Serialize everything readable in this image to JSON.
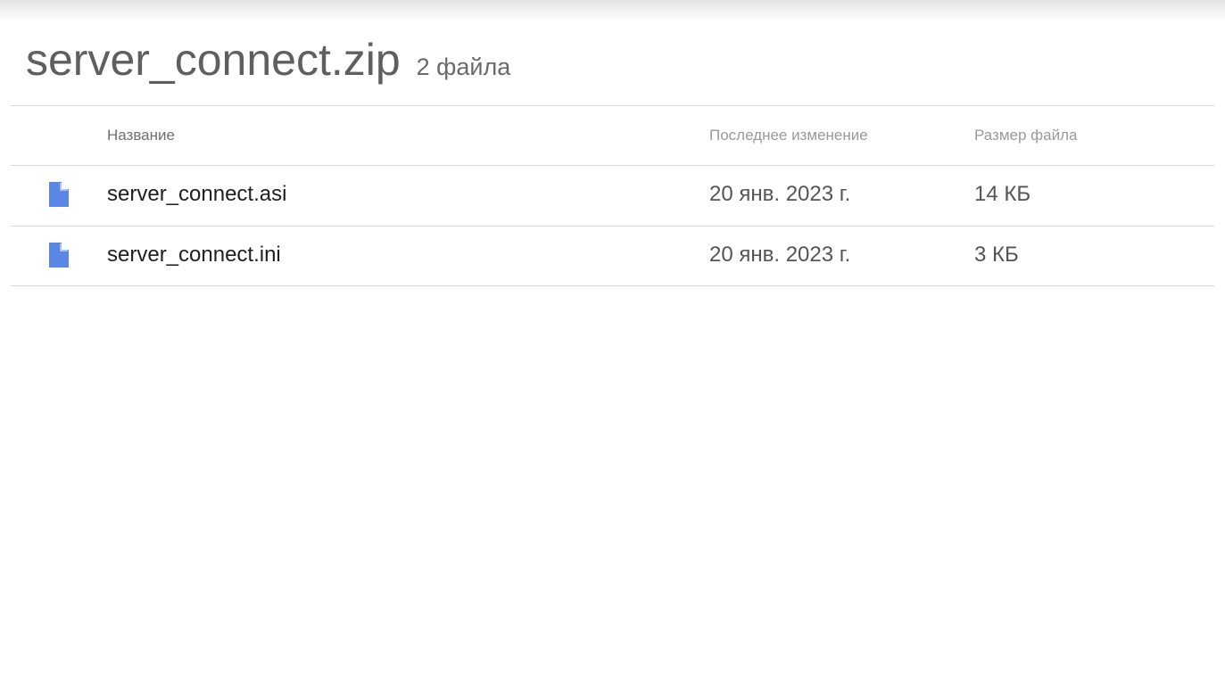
{
  "archive": {
    "title": "server_connect.zip",
    "count": "2 файла"
  },
  "columns": {
    "name": "Название",
    "modified": "Последнее изменение",
    "size": "Размер файла"
  },
  "files": [
    {
      "icon": "file-icon",
      "name": "server_connect.asi",
      "modified": "20 янв. 2023 г.",
      "size": "14 КБ"
    },
    {
      "icon": "file-icon",
      "name": "server_connect.ini",
      "modified": "20 янв. 2023 г.",
      "size": "3 КБ"
    }
  ],
  "colors": {
    "icon": "#5a86e6"
  }
}
